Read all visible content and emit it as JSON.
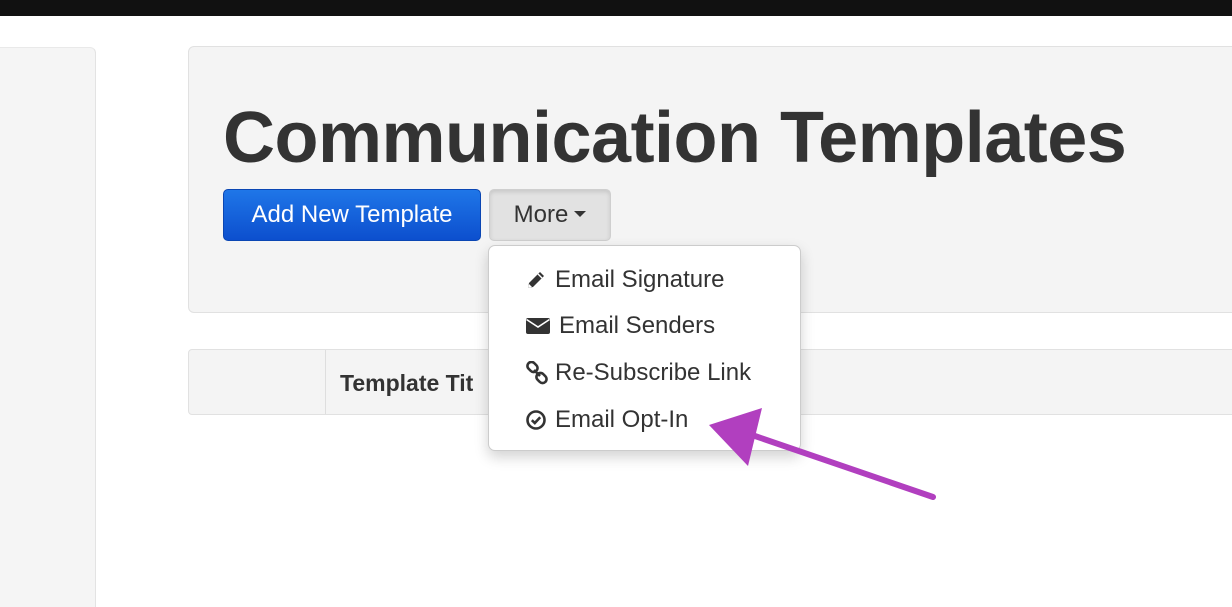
{
  "page": {
    "title": "Communication Templates"
  },
  "toolbar": {
    "add_label": "Add New Template",
    "more_label": "More"
  },
  "dropdown": {
    "items": [
      {
        "label": "Email Signature",
        "icon": "pencil-icon"
      },
      {
        "label": "Email Senders",
        "icon": "envelope-icon"
      },
      {
        "label": "Re-Subscribe Link",
        "icon": "link-icon"
      },
      {
        "label": "Email Opt-In",
        "icon": "check-circle-icon"
      }
    ]
  },
  "table": {
    "columns": [
      "",
      "Template Tit"
    ]
  },
  "colors": {
    "primary": "#0c4fce",
    "annotation_arrow": "#b13fbf",
    "title_text": "#333333"
  }
}
